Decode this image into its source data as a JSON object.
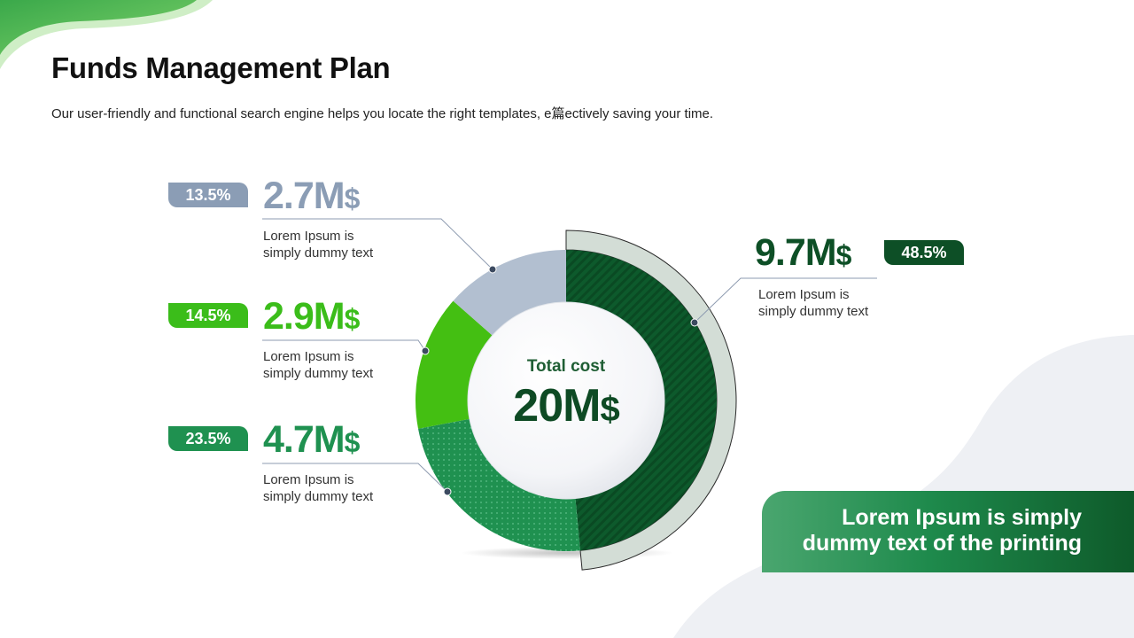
{
  "header": {
    "title": "Funds Management Plan",
    "subtitle": "Our user-friendly and functional search engine helps you locate the right templates, e篇ectively saving your time."
  },
  "center": {
    "label": "Total cost",
    "value": "20M",
    "unit": "$"
  },
  "banner": {
    "line1": "Lorem Ipsum is simply",
    "line2": "dummy text of the printing"
  },
  "colors": {
    "slate": "#8b9db5",
    "lime": "#3bbd1a",
    "green": "#1f9150",
    "dark_green": "#0d4f26"
  },
  "items": [
    {
      "percent": "13.5%",
      "value": "2.7M",
      "unit": "$",
      "desc1": "Lorem Ipsum is",
      "desc2": "simply dummy text",
      "color": "#8b9db5"
    },
    {
      "percent": "14.5%",
      "value": "2.9M",
      "unit": "$",
      "desc1": "Lorem Ipsum is",
      "desc2": "simply dummy text",
      "color": "#3bbd1a"
    },
    {
      "percent": "23.5%",
      "value": "4.7M",
      "unit": "$",
      "desc1": "Lorem Ipsum is",
      "desc2": "simply dummy text",
      "color": "#1f9150"
    },
    {
      "percent": "48.5%",
      "value": "9.7M",
      "unit": "$",
      "desc1": "Lorem Ipsum is",
      "desc2": "simply dummy text",
      "color": "#0d4f26"
    }
  ],
  "chart_data": {
    "type": "pie",
    "title": "",
    "total": 20,
    "slices": [
      {
        "label": "9.7M$",
        "value": 48.5,
        "color": "#0d5a2c"
      },
      {
        "label": "4.7M$",
        "value": 23.5,
        "color": "#1f9150"
      },
      {
        "label": "2.9M$",
        "value": 14.5,
        "color": "#44bf12"
      },
      {
        "label": "2.7M$",
        "value": 13.5,
        "color": "#b2bfd0"
      }
    ]
  }
}
